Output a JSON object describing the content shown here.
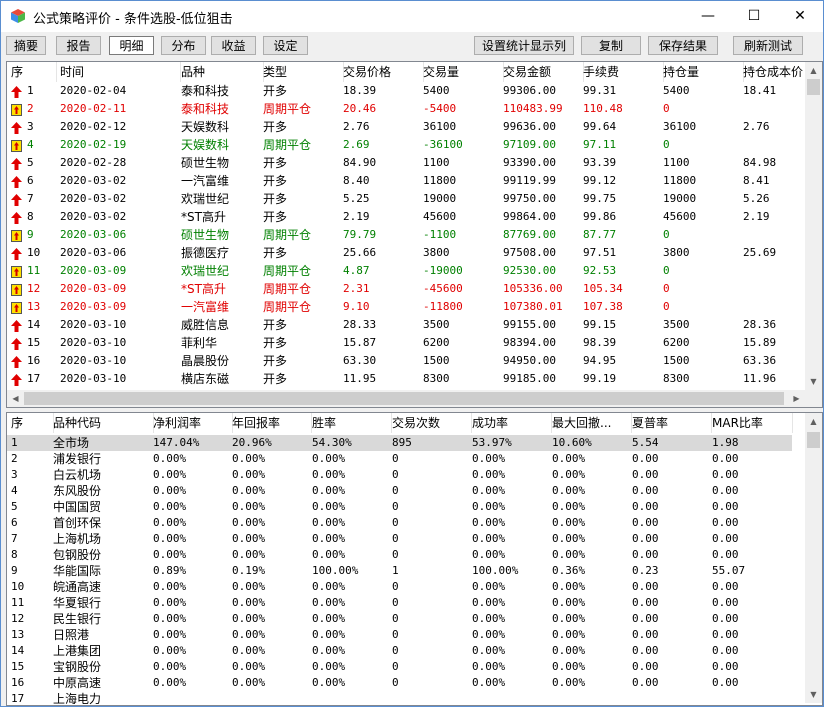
{
  "window": {
    "title": "公式策略评价 - 条件选股-低位狙击",
    "min": "—",
    "max": "☐",
    "close": "✕"
  },
  "toolbar": {
    "tabs": [
      "摘要",
      "报告",
      "明细",
      "分布",
      "收益",
      "设定"
    ],
    "active_tab": "明细",
    "buttons": [
      "设置统计显示列",
      "复制",
      "保存结果",
      "刷新测试"
    ]
  },
  "colors": {
    "red": "#e00000",
    "green": "#008000",
    "accent_border": "#5a8ed0"
  },
  "trades": {
    "columns": [
      "序",
      "时间",
      "品种",
      "类型",
      "交易价格",
      "交易量",
      "交易金额",
      "手续费",
      "持仓量",
      "持仓成本价"
    ],
    "rows": [
      {
        "icon": "buy-arrow-icon",
        "c": "",
        "no": "1",
        "date": "2020-02-04",
        "name": "泰和科技",
        "type": "开多",
        "price": "18.39",
        "vol": "5400",
        "amt": "99306.00",
        "fee": "99.31",
        "pos": "5400",
        "cost": "18.41"
      },
      {
        "icon": "sell-flag-icon",
        "c": "red",
        "no": "2",
        "date": "2020-02-11",
        "name": "泰和科技",
        "type": "周期平仓",
        "price": "20.46",
        "vol": "-5400",
        "amt": "110483.99",
        "fee": "110.48",
        "pos": "0",
        "cost": ""
      },
      {
        "icon": "buy-arrow-icon",
        "c": "",
        "no": "3",
        "date": "2020-02-12",
        "name": "天娱数科",
        "type": "开多",
        "price": "2.76",
        "vol": "36100",
        "amt": "99636.00",
        "fee": "99.64",
        "pos": "36100",
        "cost": "2.76"
      },
      {
        "icon": "sell-flag-icon",
        "c": "green",
        "no": "4",
        "date": "2020-02-19",
        "name": "天娱数科",
        "type": "周期平仓",
        "price": "2.69",
        "vol": "-36100",
        "amt": "97109.00",
        "fee": "97.11",
        "pos": "0",
        "cost": ""
      },
      {
        "icon": "buy-arrow-icon",
        "c": "",
        "no": "5",
        "date": "2020-02-28",
        "name": "硕世生物",
        "type": "开多",
        "price": "84.90",
        "vol": "1100",
        "amt": "93390.00",
        "fee": "93.39",
        "pos": "1100",
        "cost": "84.98"
      },
      {
        "icon": "buy-arrow-icon",
        "c": "",
        "no": "6",
        "date": "2020-03-02",
        "name": "一汽富维",
        "type": "开多",
        "price": "8.40",
        "vol": "11800",
        "amt": "99119.99",
        "fee": "99.12",
        "pos": "11800",
        "cost": "8.41"
      },
      {
        "icon": "buy-arrow-icon",
        "c": "",
        "no": "7",
        "date": "2020-03-02",
        "name": "欢瑞世纪",
        "type": "开多",
        "price": "5.25",
        "vol": "19000",
        "amt": "99750.00",
        "fee": "99.75",
        "pos": "19000",
        "cost": "5.26"
      },
      {
        "icon": "buy-arrow-icon",
        "c": "",
        "no": "8",
        "date": "2020-03-02",
        "name": "*ST高升",
        "type": "开多",
        "price": "2.19",
        "vol": "45600",
        "amt": "99864.00",
        "fee": "99.86",
        "pos": "45600",
        "cost": "2.19"
      },
      {
        "icon": "sell-flag-icon",
        "c": "green",
        "no": "9",
        "date": "2020-03-06",
        "name": "硕世生物",
        "type": "周期平仓",
        "price": "79.79",
        "vol": "-1100",
        "amt": "87769.00",
        "fee": "87.77",
        "pos": "0",
        "cost": ""
      },
      {
        "icon": "buy-arrow-icon",
        "c": "",
        "no": "10",
        "date": "2020-03-06",
        "name": "振德医疗",
        "type": "开多",
        "price": "25.66",
        "vol": "3800",
        "amt": "97508.00",
        "fee": "97.51",
        "pos": "3800",
        "cost": "25.69"
      },
      {
        "icon": "sell-flag-icon",
        "c": "green",
        "no": "11",
        "date": "2020-03-09",
        "name": "欢瑞世纪",
        "type": "周期平仓",
        "price": "4.87",
        "vol": "-19000",
        "amt": "92530.00",
        "fee": "92.53",
        "pos": "0",
        "cost": ""
      },
      {
        "icon": "sell-flag-icon",
        "c": "red",
        "no": "12",
        "date": "2020-03-09",
        "name": "*ST高升",
        "type": "周期平仓",
        "price": "2.31",
        "vol": "-45600",
        "amt": "105336.00",
        "fee": "105.34",
        "pos": "0",
        "cost": ""
      },
      {
        "icon": "sell-flag-icon",
        "c": "red",
        "no": "13",
        "date": "2020-03-09",
        "name": "一汽富维",
        "type": "周期平仓",
        "price": "9.10",
        "vol": "-11800",
        "amt": "107380.01",
        "fee": "107.38",
        "pos": "0",
        "cost": ""
      },
      {
        "icon": "buy-arrow-icon",
        "c": "",
        "no": "14",
        "date": "2020-03-10",
        "name": "威胜信息",
        "type": "开多",
        "price": "28.33",
        "vol": "3500",
        "amt": "99155.00",
        "fee": "99.15",
        "pos": "3500",
        "cost": "28.36"
      },
      {
        "icon": "buy-arrow-icon",
        "c": "",
        "no": "15",
        "date": "2020-03-10",
        "name": "菲利华",
        "type": "开多",
        "price": "15.87",
        "vol": "6200",
        "amt": "98394.00",
        "fee": "98.39",
        "pos": "6200",
        "cost": "15.89"
      },
      {
        "icon": "buy-arrow-icon",
        "c": "",
        "no": "16",
        "date": "2020-03-10",
        "name": "晶晨股份",
        "type": "开多",
        "price": "63.30",
        "vol": "1500",
        "amt": "94950.00",
        "fee": "94.95",
        "pos": "1500",
        "cost": "63.36"
      },
      {
        "icon": "buy-arrow-icon",
        "c": "",
        "no": "17",
        "date": "2020-03-10",
        "name": "横店东磁",
        "type": "开多",
        "price": "11.95",
        "vol": "8300",
        "amt": "99185.00",
        "fee": "99.19",
        "pos": "8300",
        "cost": "11.96"
      }
    ]
  },
  "stats": {
    "columns": [
      "序",
      "品种代码",
      "净利润率",
      "年回报率",
      "胜率",
      "交易次数",
      "成功率",
      "最大回撤...",
      "夏普率",
      "MAR比率"
    ],
    "rows": [
      [
        "1",
        "全市场",
        "147.04%",
        "20.96%",
        "54.30%",
        "895",
        "53.97%",
        "10.60%",
        "5.54",
        "1.98"
      ],
      [
        "2",
        "浦发银行",
        "0.00%",
        "0.00%",
        "0.00%",
        "0",
        "0.00%",
        "0.00%",
        "0.00",
        "0.00"
      ],
      [
        "3",
        "白云机场",
        "0.00%",
        "0.00%",
        "0.00%",
        "0",
        "0.00%",
        "0.00%",
        "0.00",
        "0.00"
      ],
      [
        "4",
        "东风股份",
        "0.00%",
        "0.00%",
        "0.00%",
        "0",
        "0.00%",
        "0.00%",
        "0.00",
        "0.00"
      ],
      [
        "5",
        "中国国贸",
        "0.00%",
        "0.00%",
        "0.00%",
        "0",
        "0.00%",
        "0.00%",
        "0.00",
        "0.00"
      ],
      [
        "6",
        "首创环保",
        "0.00%",
        "0.00%",
        "0.00%",
        "0",
        "0.00%",
        "0.00%",
        "0.00",
        "0.00"
      ],
      [
        "7",
        "上海机场",
        "0.00%",
        "0.00%",
        "0.00%",
        "0",
        "0.00%",
        "0.00%",
        "0.00",
        "0.00"
      ],
      [
        "8",
        "包钢股份",
        "0.00%",
        "0.00%",
        "0.00%",
        "0",
        "0.00%",
        "0.00%",
        "0.00",
        "0.00"
      ],
      [
        "9",
        "华能国际",
        "0.89%",
        "0.19%",
        "100.00%",
        "1",
        "100.00%",
        "0.36%",
        "0.23",
        "55.07"
      ],
      [
        "10",
        "皖通高速",
        "0.00%",
        "0.00%",
        "0.00%",
        "0",
        "0.00%",
        "0.00%",
        "0.00",
        "0.00"
      ],
      [
        "11",
        "华夏银行",
        "0.00%",
        "0.00%",
        "0.00%",
        "0",
        "0.00%",
        "0.00%",
        "0.00",
        "0.00"
      ],
      [
        "12",
        "民生银行",
        "0.00%",
        "0.00%",
        "0.00%",
        "0",
        "0.00%",
        "0.00%",
        "0.00",
        "0.00"
      ],
      [
        "13",
        "日照港",
        "0.00%",
        "0.00%",
        "0.00%",
        "0",
        "0.00%",
        "0.00%",
        "0.00",
        "0.00"
      ],
      [
        "14",
        "上港集团",
        "0.00%",
        "0.00%",
        "0.00%",
        "0",
        "0.00%",
        "0.00%",
        "0.00",
        "0.00"
      ],
      [
        "15",
        "宝钢股份",
        "0.00%",
        "0.00%",
        "0.00%",
        "0",
        "0.00%",
        "0.00%",
        "0.00",
        "0.00"
      ],
      [
        "16",
        "中原高速",
        "0.00%",
        "0.00%",
        "0.00%",
        "0",
        "0.00%",
        "0.00%",
        "0.00",
        "0.00"
      ],
      [
        "17",
        "上海电力",
        "",
        "",
        "",
        "",
        "",
        "",
        "",
        ""
      ]
    ],
    "selected_row": "1"
  }
}
